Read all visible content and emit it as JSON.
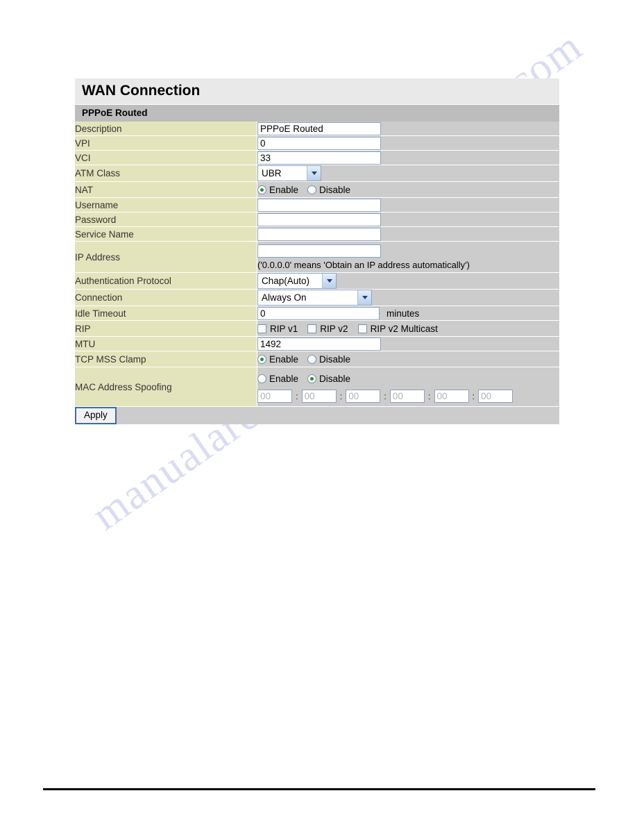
{
  "page": {
    "title": "WAN Connection",
    "subtitle": "PPPoE Routed",
    "watermark_text_1": "manualarchive.com",
    "watermark_text_2": "manualarchive.com"
  },
  "labels": {
    "description": "Description",
    "vpi": "VPI",
    "vci": "VCI",
    "atm_class": "ATM Class",
    "nat": "NAT",
    "username": "Username",
    "password": "Password",
    "service_name": "Service Name",
    "ip_address": "IP Address",
    "auth_protocol": "Authentication Protocol",
    "connection": "Connection",
    "idle_timeout": "Idle Timeout",
    "rip": "RIP",
    "mtu": "MTU",
    "tcp_mss_clamp": "TCP MSS Clamp",
    "mac_address_spoofing": "MAC Address Spoofing"
  },
  "fields": {
    "description_value": "PPPoE Routed",
    "vpi_value": "0",
    "vci_value": "33",
    "atm_class_value": "UBR",
    "username_value": "",
    "password_value": "",
    "service_name_value": "",
    "ip_address_value": "",
    "ip_address_hint": "('0.0.0.0' means 'Obtain an IP address automatically')",
    "auth_protocol_value": "Chap(Auto)",
    "connection_value": "Always On",
    "idle_timeout_value": "0",
    "idle_timeout_unit": "minutes",
    "mtu_value": "1492"
  },
  "radios": {
    "enable_label": "Enable",
    "disable_label": "Disable",
    "nat_selected": "Enable",
    "tcp_mss_clamp_selected": "Enable",
    "mac_spoofing_selected": "Disable"
  },
  "rip_options": [
    {
      "label": "RIP v1",
      "checked": false
    },
    {
      "label": "RIP v2",
      "checked": false
    },
    {
      "label": "RIP v2 Multicast",
      "checked": false
    }
  ],
  "mac_octets": [
    "00",
    "00",
    "00",
    "00",
    "00",
    "00"
  ],
  "mac_separator": ":",
  "buttons": {
    "apply": "Apply"
  },
  "colors": {
    "label_column": "#e3e4bc",
    "field_column": "#cccccc",
    "title_bar": "#e9e9e9",
    "subtitle_bar": "#bdbdbd",
    "input_border": "#8ea2bd",
    "radio_selected": "#2e8b2e",
    "watermark": "#d9dcf2"
  }
}
